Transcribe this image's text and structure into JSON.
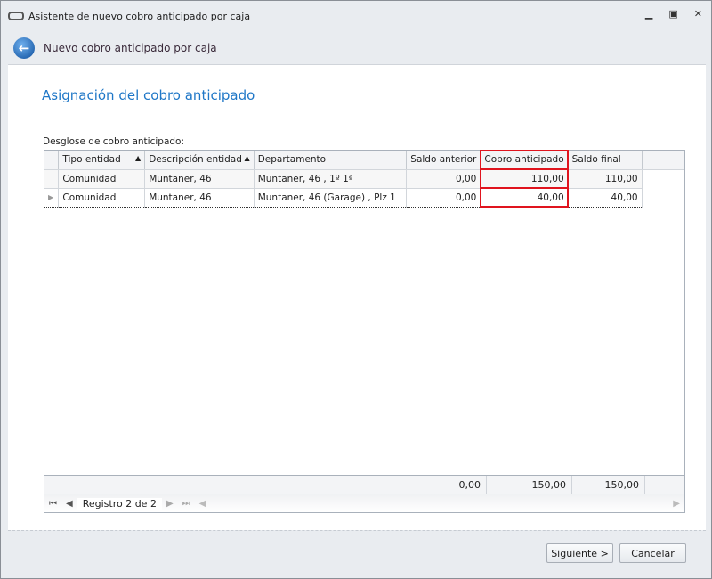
{
  "window": {
    "title": "Asistente de nuevo cobro anticipado por caja"
  },
  "header": {
    "title": "Nuevo cobro anticipado por caja"
  },
  "page": {
    "title": "Asignación del cobro anticipado",
    "grid_label": "Desglose de cobro anticipado:"
  },
  "grid": {
    "columns": [
      "Tipo entidad",
      "Descripción entidad",
      "Departamento",
      "Saldo anterior",
      "Cobro anticipado",
      "Saldo final"
    ],
    "rows": [
      [
        "Comunidad",
        "Muntaner, 46",
        "Muntaner, 46 , 1º 1ª",
        "0,00",
        "110,00",
        "110,00"
      ],
      [
        "Comunidad",
        "Muntaner, 46",
        "Muntaner, 46 (Garage) , Plz 1",
        "0,00",
        "40,00",
        "40,00"
      ]
    ],
    "totals": {
      "saldo_anterior": "0,00",
      "cobro_anticipado": "150,00",
      "saldo_final": "150,00"
    },
    "navigator": "Registro 2 de 2"
  },
  "buttons": {
    "next": "Siguiente >",
    "cancel": "Cancelar"
  },
  "colors": {
    "accent": "#1f77c7",
    "highlight": "#e0141e"
  }
}
